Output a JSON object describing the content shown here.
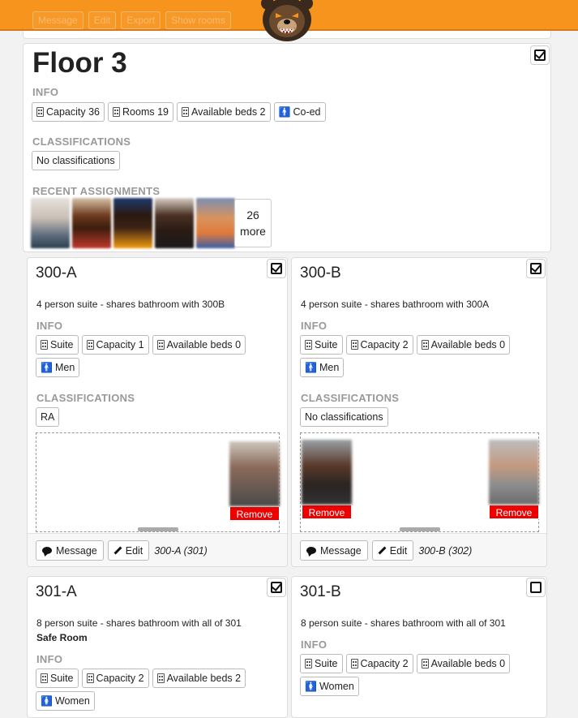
{
  "topbar": {
    "buttons": [
      "Message",
      "Edit",
      "Export",
      "Show rooms"
    ],
    "brand_color": "#f7941d"
  },
  "floor": {
    "title": "Floor 3",
    "checked": true,
    "info_label": "INFO",
    "info_tags": [
      {
        "icon": "building-icon",
        "text": "Capacity 36"
      },
      {
        "icon": "building-icon",
        "text": "Rooms 19"
      },
      {
        "icon": "building-icon",
        "text": "Available beds 2"
      },
      {
        "icon": "person-icon",
        "text": "Co-ed"
      }
    ],
    "classifications_label": "CLASSIFICATIONS",
    "classifications": [
      "No classifications"
    ],
    "recent_label": "RECENT ASSIGNMENTS",
    "more_count": "26",
    "more_label": "more"
  },
  "rooms": [
    {
      "name": "300-A",
      "checked": true,
      "description": "4 person suite - shares bathroom with 300B",
      "note": "",
      "info_label": "INFO",
      "tags": [
        "Suite",
        "Capacity 1",
        "Available beds 0"
      ],
      "gender": "Men",
      "classifications_label": "CLASSIFICATIONS",
      "classifications": [
        "RA"
      ],
      "occupant_action": "Remove",
      "message_label": "Message",
      "edit_label": "Edit",
      "code": "300-A (301)"
    },
    {
      "name": "300-B",
      "checked": true,
      "description": "4 person suite - shares bathroom with 300A",
      "note": "",
      "info_label": "INFO",
      "tags": [
        "Suite",
        "Capacity 2",
        "Available beds 0"
      ],
      "gender": "Men",
      "classifications_label": "CLASSIFICATIONS",
      "classifications": [
        "No classifications"
      ],
      "occupant_action": "Remove",
      "message_label": "Message",
      "edit_label": "Edit",
      "code": "300-B (302)"
    },
    {
      "name": "301-A",
      "checked": true,
      "description": "8 person suite - shares bathroom with all of 301",
      "note": "Safe Room",
      "info_label": "INFO",
      "tags": [
        "Suite",
        "Capacity 2",
        "Available beds 2"
      ],
      "gender": "Women"
    },
    {
      "name": "301-B",
      "checked": false,
      "description": "8 person suite - shares bathroom with all of 301",
      "note": "",
      "info_label": "INFO",
      "tags": [
        "Suite",
        "Capacity 2",
        "Available beds 0"
      ],
      "gender": "Women"
    }
  ]
}
